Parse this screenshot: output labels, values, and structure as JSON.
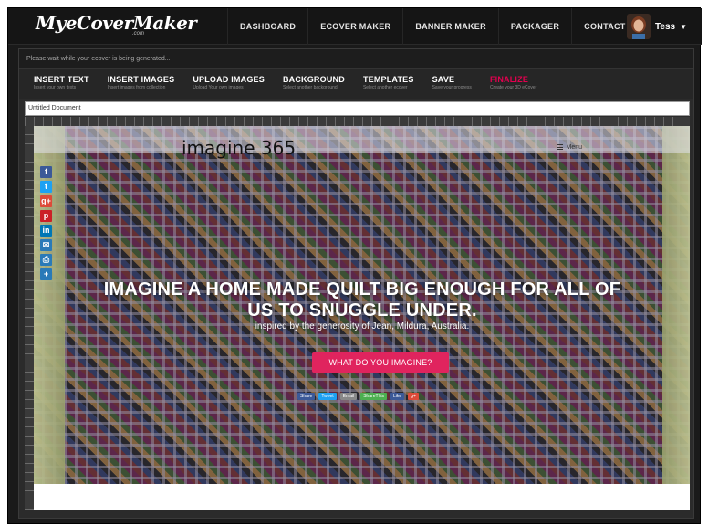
{
  "app": {
    "logo": "MyeCoverMaker",
    "logo_sub": ".com",
    "nav": [
      "DASHBOARD",
      "ECOVER MAKER",
      "BANNER MAKER",
      "PACKAGER",
      "CONTACT"
    ],
    "user": {
      "name": "Tess",
      "caret": "▼"
    }
  },
  "editor": {
    "status": "Please wait while your ecover is being generated...",
    "tools": [
      {
        "title": "INSERT TEXT",
        "desc": "Insert your own texts"
      },
      {
        "title": "INSERT IMAGES",
        "desc": "Insert images from collection"
      },
      {
        "title": "UPLOAD IMAGES",
        "desc": "Upload Your own images"
      },
      {
        "title": "BACKGROUND",
        "desc": "Select another background"
      },
      {
        "title": "TEMPLATES",
        "desc": "Select another ecover"
      },
      {
        "title": "SAVE",
        "desc": "Save your progress"
      },
      {
        "title": "FINALIZE",
        "desc": "Create your 3D eCover"
      }
    ],
    "document_name": "Untitled Document"
  },
  "canvas": {
    "site_title": "imagine 365",
    "menu_label": "Menu",
    "headline": "IMAGINE A HOME MADE QUILT BIG ENOUGH FOR ALL OF US TO SNUGGLE UNDER.",
    "subline": "inspired by the generosity of Jean, Mildura, Australia.",
    "cta": "WHAT DO YOU IMAGINE?",
    "social_icons": [
      {
        "glyph": "f",
        "name": "facebook-icon",
        "color": "#3b5998"
      },
      {
        "glyph": "t",
        "name": "twitter-icon",
        "color": "#1da1f2"
      },
      {
        "glyph": "g+",
        "name": "google-plus-icon",
        "color": "#dd4b39"
      },
      {
        "glyph": "p",
        "name": "pinterest-icon",
        "color": "#cb2027"
      },
      {
        "glyph": "in",
        "name": "linkedin-icon",
        "color": "#0077b5"
      },
      {
        "glyph": "✉",
        "name": "email-icon",
        "color": "#2a7ab8"
      },
      {
        "glyph": "⎙",
        "name": "print-icon",
        "color": "#2a7ab8"
      },
      {
        "glyph": "+",
        "name": "more-share-icon",
        "color": "#2a7ab8"
      }
    ],
    "share_buttons": [
      {
        "label": "Share",
        "color": "#3b5998"
      },
      {
        "label": "Tweet",
        "color": "#1da1f2"
      },
      {
        "label": "Email",
        "color": "#888888"
      },
      {
        "label": "ShareThis",
        "color": "#4caf50"
      },
      {
        "label": "Like",
        "color": "#3b5998"
      },
      {
        "label": "g+",
        "color": "#dd4b39"
      }
    ]
  }
}
